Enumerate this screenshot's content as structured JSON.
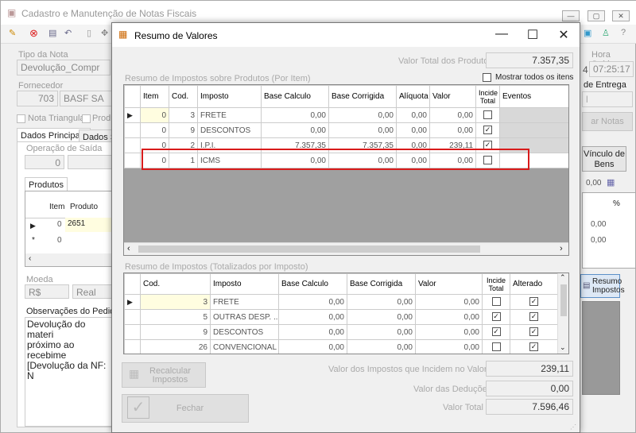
{
  "bg": {
    "title": "Cadastro e Manutenção de Notas Fiscais",
    "tipo_nota_label": "Tipo da Nota",
    "tipo_nota_value": "Devolução_Compr",
    "fornecedor_label": "Fornecedor",
    "fornecedor_code": "703",
    "fornecedor_name": "BASF SA",
    "nota_triangular": "Nota Triangular",
    "produto_chk": "Produt",
    "tab_dados_principais": "Dados Principais",
    "tab_dados_se": "Dados Se",
    "operacao_saida_label": "Operação de Saída",
    "operacao_value": "0",
    "produtos_tab": "Produtos",
    "prod_grid_item": "Item",
    "prod_grid_produto": "Produto",
    "prod_row1_item": "0",
    "prod_row1_prod": "2651",
    "prod_row2_item": "0",
    "moeda_label": "Moeda",
    "moeda_code": "R$",
    "moeda_name": "Real",
    "obs_label": "Observações do Pedido",
    "obs_line1": "Devolução do materi",
    "obs_line2": "próximo ao recebime",
    "obs_line3": "[Devolução da NF: N",
    "hora_saida_label": "Hora Saída",
    "hora_saida_value": "07:25:17",
    "hora_prefix": "4",
    "entrega_label": "de Entrega",
    "notas_btn": "ar Notas",
    "vinculo_btn": "Vínculo de Bens",
    "right_val1": "0,00",
    "right_val2": "0,00",
    "right_val3": "0,00",
    "right_pct": "%",
    "resumo_btn": "Resumo Impostos"
  },
  "dlg": {
    "title": "Resumo de Valores",
    "valor_total_produtos_label": "Valor Total dos Produtos",
    "valor_total_produtos": "7.357,35",
    "grid1_label": "Resumo de Impostos sobre Produtos (Por Item)",
    "mostrar_todos": "Mostrar todos os itens",
    "grid1_headers": [
      "Item",
      "Cod.",
      "Imposto",
      "Base Calculo",
      "Base Corrigida",
      "Alíquota",
      "Valor",
      "Incide Total",
      "Eventos"
    ],
    "grid1_rows": [
      {
        "item": "0",
        "cod": "3",
        "imposto": "FRETE",
        "base": "0,00",
        "corr": "0,00",
        "aliq": "0,00",
        "valor": "0,00",
        "incide": false
      },
      {
        "item": "0",
        "cod": "9",
        "imposto": "DESCONTOS",
        "base": "0,00",
        "corr": "0,00",
        "aliq": "0,00",
        "valor": "0,00",
        "incide": true
      },
      {
        "item": "0",
        "cod": "2",
        "imposto": "I.P.I.",
        "base": "7.357,35",
        "corr": "7.357,35",
        "aliq": "0,00",
        "valor": "239,11",
        "incide": true
      },
      {
        "item": "0",
        "cod": "1",
        "imposto": "ICMS",
        "base": "0,00",
        "corr": "0,00",
        "aliq": "0,00",
        "valor": "0,00",
        "incide": false
      }
    ],
    "grid2_label": "Resumo de Impostos (Totalizados por Imposto)",
    "grid2_headers": [
      "Cod.",
      "Imposto",
      "Base Calculo",
      "Base Corrigida",
      "Valor",
      "Incide Total",
      "Alterado"
    ],
    "grid2_rows": [
      {
        "cod": "3",
        "imposto": "FRETE",
        "base": "0,00",
        "corr": "0,00",
        "valor": "0,00",
        "incide": false,
        "alterado": true
      },
      {
        "cod": "5",
        "imposto": "OUTRAS DESP. ...",
        "base": "0,00",
        "corr": "0,00",
        "valor": "0,00",
        "incide": true,
        "alterado": true
      },
      {
        "cod": "9",
        "imposto": "DESCONTOS",
        "base": "0,00",
        "corr": "0,00",
        "valor": "0,00",
        "incide": true,
        "alterado": true
      },
      {
        "cod": "26",
        "imposto": "CONVENCIONAL",
        "base": "0,00",
        "corr": "0,00",
        "valor": "0,00",
        "incide": false,
        "alterado": true
      }
    ],
    "recalcular_btn": "Recalcular Impostos",
    "fechar_btn": "Fechar",
    "valor_impostos_label": "Valor dos Impostos que Incidem no Valor Total",
    "valor_impostos": "239,11",
    "valor_deducoes_label": "Valor das Deduções",
    "valor_deducoes": "0,00",
    "valor_total_label": "Valor Total",
    "valor_total": "7.596,46"
  },
  "colors": {
    "highlight": "#d81b1b",
    "selected_cell": "#fffde0"
  }
}
